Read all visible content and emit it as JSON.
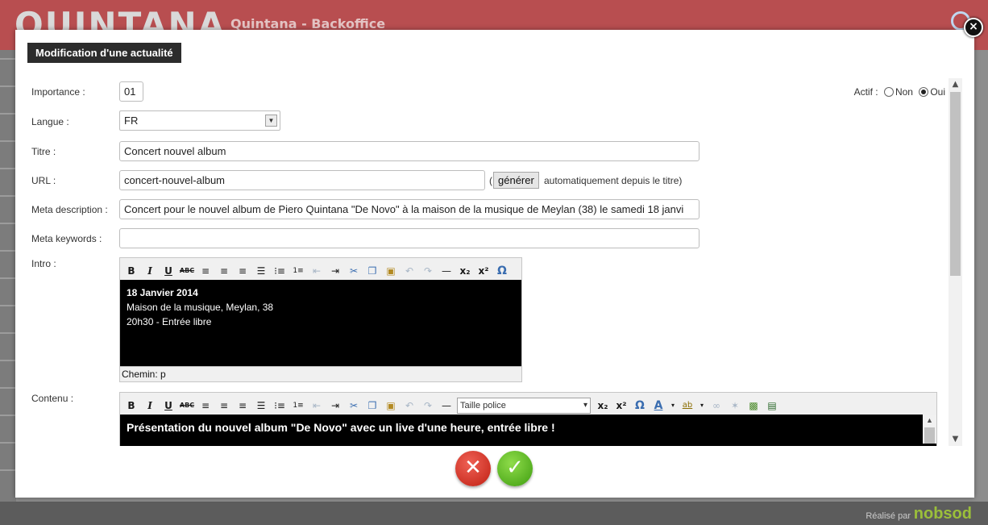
{
  "background": {
    "logo": "QUINTANA",
    "subtitle": "Quintana - Backoffice",
    "footer_text": "Réalisé par",
    "footer_brand": "nobsod"
  },
  "modal": {
    "title": "Modification d'une actualité",
    "close_glyph": "×"
  },
  "form": {
    "importance": {
      "label": "Importance :",
      "value": "01"
    },
    "actif": {
      "label": "Actif :",
      "option_no": "Non",
      "option_yes": "Oui",
      "selected": "Oui"
    },
    "langue": {
      "label": "Langue :",
      "value": "FR"
    },
    "titre": {
      "label": "Titre :",
      "value": "Concert nouvel album"
    },
    "url": {
      "label": "URL :",
      "value": "concert-nouvel-album",
      "paren_open": "(",
      "generate_button": "générer",
      "hint": "automatiquement depuis le titre)"
    },
    "meta_description": {
      "label": "Meta description :",
      "value": "Concert pour le nouvel album de Piero Quintana \"De Novo\" à la maison de la musique de Meylan (38) le samedi 18 janvi"
    },
    "meta_keywords": {
      "label": "Meta keywords :",
      "value": ""
    },
    "intro": {
      "label": "Intro :",
      "lines": [
        "18 Janvier 2014",
        "Maison de la musique, Meylan, 38",
        "20h30 - Entrée libre"
      ],
      "status": "Chemin: p"
    },
    "contenu": {
      "label": "Contenu :",
      "font_size_select": "Taille police",
      "text": "Présentation du nouvel album \"De Novo\" avec un live d'une heure, entrée libre !"
    }
  },
  "toolbar_icons": [
    "bold-icon",
    "italic-icon",
    "underline-icon",
    "strikethrough-icon",
    "align-left-icon",
    "align-center-icon",
    "align-right-icon",
    "align-justify-icon",
    "bullet-list-icon",
    "numbered-list-icon",
    "outdent-icon",
    "indent-icon",
    "cut-icon",
    "copy-icon",
    "paste-icon",
    "undo-icon",
    "redo-icon",
    "horizontal-rule-icon",
    "subscript-icon",
    "superscript-icon",
    "special-char-icon"
  ],
  "colors": {
    "header": "#b84e50",
    "cancel": "#c8281b",
    "confirm": "#4fae17",
    "editor_bg": "#000000"
  }
}
